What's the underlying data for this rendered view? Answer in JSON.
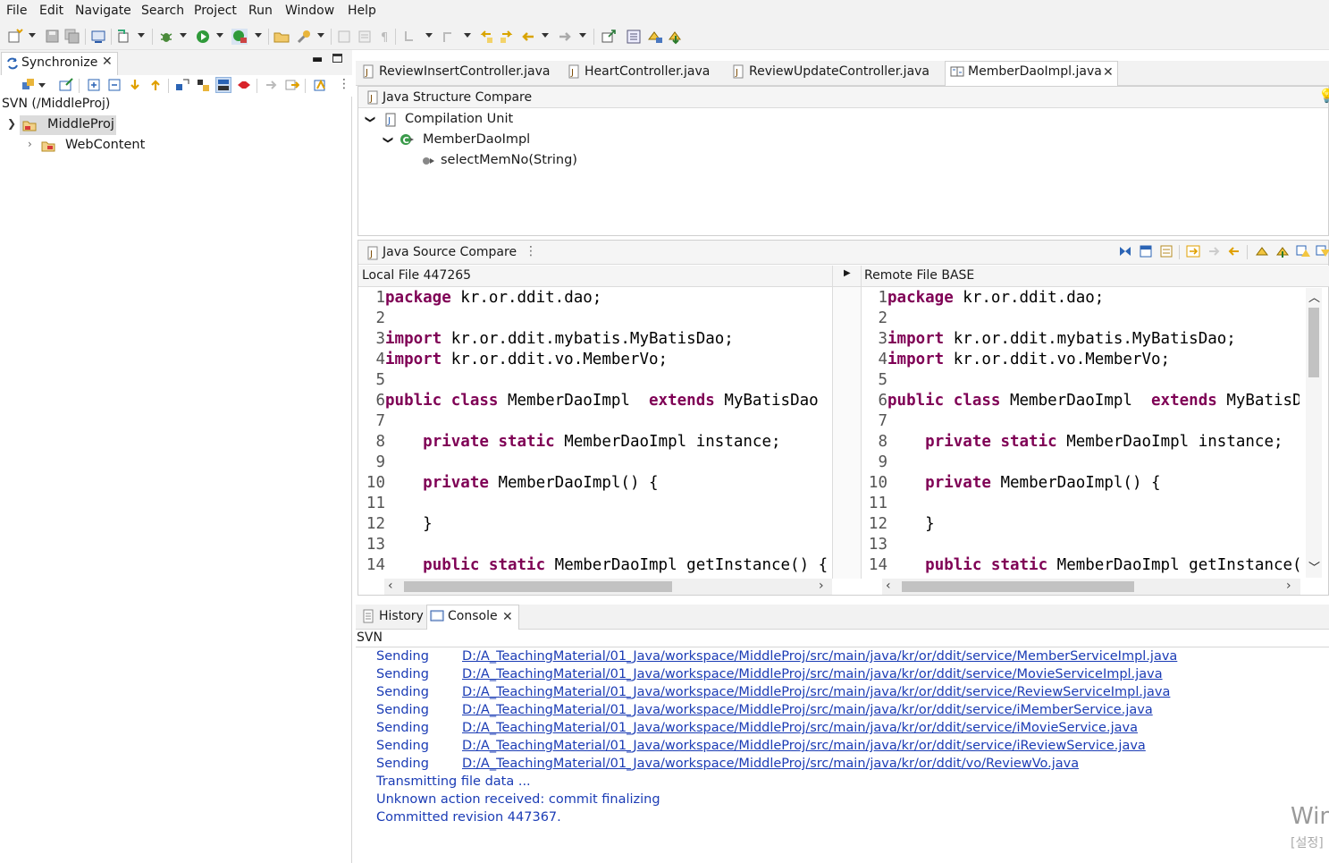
{
  "menu": [
    "File",
    "Edit",
    "Navigate",
    "Search",
    "Project",
    "Run",
    "Window",
    "Help"
  ],
  "left_panel": {
    "tab_label": "Synchronize",
    "svn_root": "SVN (/MiddleProj)",
    "tree": [
      {
        "label": "MiddleProj",
        "expanded": true,
        "selected": true
      },
      {
        "label": "WebContent",
        "expanded": false,
        "selected": false
      }
    ]
  },
  "editor_tabs": [
    {
      "label": "ReviewInsertController.java",
      "active": false
    },
    {
      "label": "HeartController.java",
      "active": false
    },
    {
      "label": "ReviewUpdateController.java",
      "active": false
    },
    {
      "label": "MemberDaoImpl.java",
      "active": true
    }
  ],
  "structure_compare": {
    "title": "Java Structure Compare",
    "nodes": [
      {
        "label": "Compilation Unit",
        "level": 0
      },
      {
        "label": "MemberDaoImpl",
        "level": 1
      },
      {
        "label": "selectMemNo(String)",
        "level": 2
      }
    ]
  },
  "source_compare": {
    "title": "Java Source Compare",
    "local_label": "Local File 447265",
    "remote_label": "Remote File BASE",
    "lines": [
      {
        "n": "1",
        "kw": "package",
        "rest": " kr.or.ddit.dao;"
      },
      {
        "n": "2",
        "kw": "",
        "rest": ""
      },
      {
        "n": "3",
        "kw": "import",
        "rest": " kr.or.ddit.mybatis.MyBatisDao;"
      },
      {
        "n": "4",
        "kw": "import",
        "rest": " kr.or.ddit.vo.MemberVo;"
      },
      {
        "n": "5",
        "kw": "",
        "rest": ""
      },
      {
        "n": "6",
        "kw": "public class",
        "rest": " MemberDaoImpl  ",
        "kw2": "extends",
        "rest2": " MyBatisDao"
      },
      {
        "n": "7",
        "kw": "",
        "rest": ""
      },
      {
        "n": "8",
        "pre": "    ",
        "kw": "private static",
        "rest": " MemberDaoImpl instance;"
      },
      {
        "n": "9",
        "kw": "",
        "rest": ""
      },
      {
        "n": "10",
        "pre": "    ",
        "kw": "private",
        "rest": " MemberDaoImpl() {"
      },
      {
        "n": "11",
        "kw": "",
        "rest": ""
      },
      {
        "n": "12",
        "pre": "    ",
        "kw": "",
        "rest": "}"
      },
      {
        "n": "13",
        "kw": "",
        "rest": ""
      },
      {
        "n": "14",
        "pre": "    ",
        "kw": "public static",
        "rest": " MemberDaoImpl getInstance() {"
      }
    ]
  },
  "bottom_tabs": [
    {
      "label": "History",
      "active": false
    },
    {
      "label": "Console",
      "active": true
    }
  ],
  "console": {
    "header": "SVN",
    "sending": [
      {
        "action": "Sending",
        "path": "D:/A_TeachingMaterial/01_Java/workspace/MiddleProj/src/main/java/kr/or/ddit/service/MemberServiceImpl.java"
      },
      {
        "action": "Sending",
        "path": "D:/A_TeachingMaterial/01_Java/workspace/MiddleProj/src/main/java/kr/or/ddit/service/MovieServiceImpl.java"
      },
      {
        "action": "Sending",
        "path": "D:/A_TeachingMaterial/01_Java/workspace/MiddleProj/src/main/java/kr/or/ddit/service/ReviewServiceImpl.java"
      },
      {
        "action": "Sending",
        "path": "D:/A_TeachingMaterial/01_Java/workspace/MiddleProj/src/main/java/kr/or/ddit/service/iMemberService.java"
      },
      {
        "action": "Sending",
        "path": "D:/A_TeachingMaterial/01_Java/workspace/MiddleProj/src/main/java/kr/or/ddit/service/iMovieService.java"
      },
      {
        "action": "Sending",
        "path": "D:/A_TeachingMaterial/01_Java/workspace/MiddleProj/src/main/java/kr/or/ddit/service/iReviewService.java"
      },
      {
        "action": "Sending",
        "path": "D:/A_TeachingMaterial/01_Java/workspace/MiddleProj/src/main/java/kr/or/ddit/vo/ReviewVo.java"
      }
    ],
    "messages": [
      "Transmitting file data ...",
      "Unknown action received: commit finalizing",
      "Committed revision 447367."
    ],
    "watermark": "Win",
    "watermark_sub": "[설정]"
  },
  "colors": {
    "keyword": "#7f0055",
    "console_text": "#1b3cb5",
    "chrome_bg": "#f2f2f2"
  }
}
